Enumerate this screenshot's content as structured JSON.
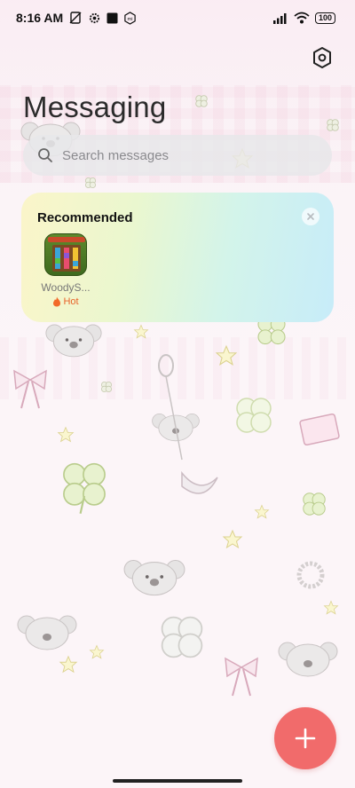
{
  "status_bar": {
    "time": "8:16 AM",
    "battery": "100",
    "icons_left": [
      "no-sim-icon",
      "gear-status-icon",
      "square-status-icon",
      "mi-icon"
    ],
    "icons_right": [
      "signal-icon",
      "wifi-icon",
      "battery-icon"
    ]
  },
  "header": {
    "title": "Messaging",
    "settings_icon": "settings-hexagon-icon"
  },
  "search": {
    "placeholder": "Search messages",
    "value": ""
  },
  "recommended": {
    "title": "Recommended",
    "apps": [
      {
        "name": "WoodyS...",
        "badge": "Hot"
      }
    ]
  },
  "fab": {
    "icon": "plus-icon"
  },
  "colors": {
    "fab": "#f16b6b",
    "hot_badge": "#e8632a"
  }
}
